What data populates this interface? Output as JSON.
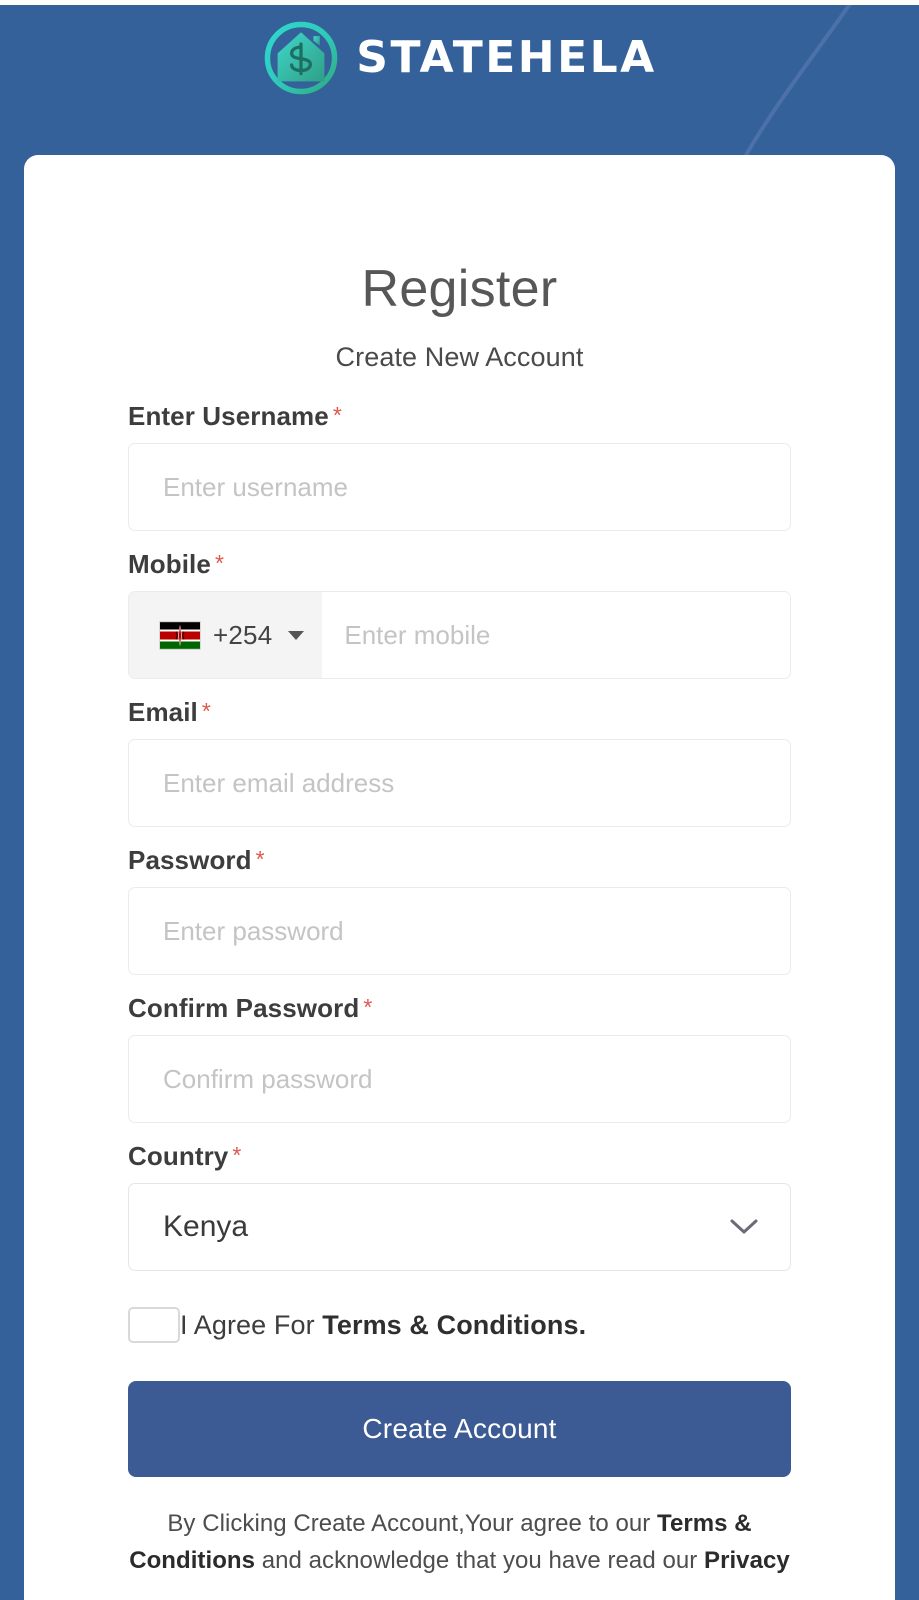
{
  "brand": {
    "name": "STATEHELA",
    "logo_icon": "house-dollar-logo-icon",
    "colors": {
      "page_background": "#35619a",
      "logo_ring_start": "#2fd1c4",
      "logo_ring_end": "#35b38a",
      "primary_button": "#3c5a93",
      "required_asterisk": "#e2574c"
    }
  },
  "card": {
    "title": "Register",
    "subtitle": "Create New Account"
  },
  "form": {
    "required_marker": "*",
    "fields": {
      "username": {
        "label": "Enter Username",
        "placeholder": "Enter username",
        "value": ""
      },
      "mobile": {
        "label": "Mobile",
        "placeholder": "Enter mobile",
        "value": "",
        "dial_code": "+254",
        "flag_icon": "kenya-flag-icon",
        "dropdown_icon": "caret-down-icon"
      },
      "email": {
        "label": "Email",
        "placeholder": "Enter email address",
        "value": ""
      },
      "password": {
        "label": "Password",
        "placeholder": "Enter password",
        "value": ""
      },
      "confirm_password": {
        "label": "Confirm Password",
        "placeholder": "Confirm password",
        "value": ""
      },
      "country": {
        "label": "Country",
        "selected": "Kenya",
        "dropdown_icon": "chevron-down-icon"
      }
    },
    "agree": {
      "checked": false,
      "text_prefix": "I Agree For ",
      "link_text": "Terms & Conditions."
    },
    "submit_label": "Create Account",
    "legal": {
      "line1_prefix": "By Clicking Create Account,Your agree to our ",
      "line1_bold": "Terms &",
      "line2_bold_start": "Conditions",
      "line2_middle": " and ",
      "line2_text": "acknowledge that you have read our ",
      "line2_bold_end": "Privacy"
    }
  }
}
